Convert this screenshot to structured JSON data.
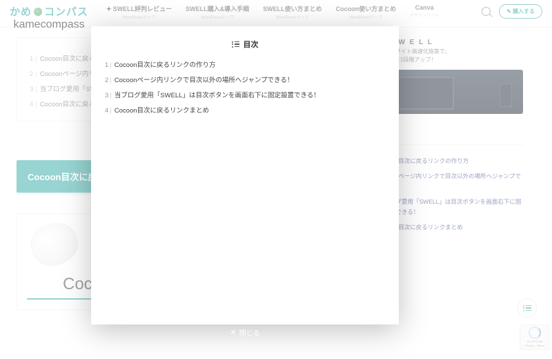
{
  "logo": {
    "pre": "かめ",
    "post": "コンパス",
    "sub": "kamecompass"
  },
  "nav": [
    {
      "t": "SWELL評判レビュー",
      "s": "WordPressテーマ",
      "bird": true
    },
    {
      "t": "SWELL購入&導入手順",
      "s": "WordPressテーマ"
    },
    {
      "t": "SWELL使い方まとめ",
      "s": "WordPressテーマ"
    },
    {
      "t": "Cocoon使い方まとめ",
      "s": "WordPressテーマ"
    },
    {
      "t": "Canva",
      "s": "デザインツール"
    }
  ],
  "buy": "購入する",
  "page_toc": [
    "Cocoon目次に戻るリンクの作り方",
    "Cocoonページ内リンクで目次以外の場所へジャンプできる！",
    "当ブログ愛用「SWELL」は目次ボタンを画面右下に固定設置できる！",
    "Cocoon目次に戻るリンクまとめ"
  ],
  "big_btn": "Cocoon目次に戻るリンクの作り方",
  "card_heading": "Cocoon",
  "promo": {
    "brand": "S W E L L",
    "l1": "SEO・サイト高速化施策で、",
    "l2": "発信力を1段階アップ！"
  },
  "side_toc": [
    "Cocoon目次に戻るリンクの作り方",
    "Cocoonページ内リンクで目次以外の場所へジャンプできる！",
    "当ブログ愛用「SWELL」は目次ボタンを画面右下に固定設置できる！",
    "Cocoon目次に戻るリンクまとめ"
  ],
  "modal": {
    "title": "目次",
    "items": [
      "Cocoon目次に戻るリンクの作り方",
      "Cocoonページ内リンクで目次以外の場所へジャンプできる！",
      "当ブログ愛用「SWELL」は目次ボタンを画面右下に固定設置できる！",
      "Cocoon目次に戻るリンクまとめ"
    ],
    "close": "閉じる"
  },
  "recaptcha": {
    "l1": "reCAPTCHA",
    "l2": "Privacy - Terms"
  }
}
